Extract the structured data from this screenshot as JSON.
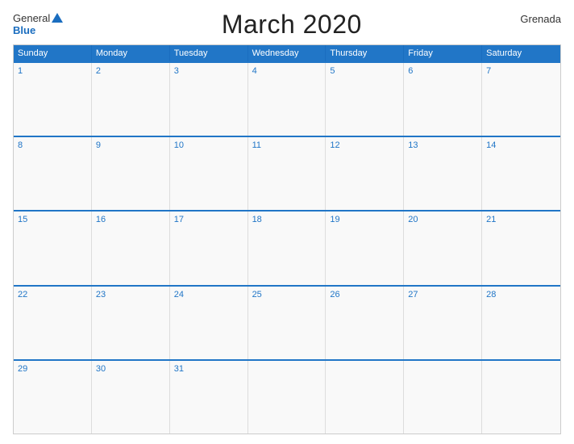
{
  "header": {
    "logo_general": "General",
    "logo_blue": "Blue",
    "title": "March 2020",
    "country": "Grenada"
  },
  "days_of_week": [
    "Sunday",
    "Monday",
    "Tuesday",
    "Wednesday",
    "Thursday",
    "Friday",
    "Saturday"
  ],
  "weeks": [
    [
      {
        "day": 1
      },
      {
        "day": 2
      },
      {
        "day": 3
      },
      {
        "day": 4
      },
      {
        "day": 5
      },
      {
        "day": 6
      },
      {
        "day": 7
      }
    ],
    [
      {
        "day": 8
      },
      {
        "day": 9
      },
      {
        "day": 10
      },
      {
        "day": 11
      },
      {
        "day": 12
      },
      {
        "day": 13
      },
      {
        "day": 14
      }
    ],
    [
      {
        "day": 15
      },
      {
        "day": 16
      },
      {
        "day": 17
      },
      {
        "day": 18
      },
      {
        "day": 19
      },
      {
        "day": 20
      },
      {
        "day": 21
      }
    ],
    [
      {
        "day": 22
      },
      {
        "day": 23
      },
      {
        "day": 24
      },
      {
        "day": 25
      },
      {
        "day": 26
      },
      {
        "day": 27
      },
      {
        "day": 28
      }
    ],
    [
      {
        "day": 29
      },
      {
        "day": 30
      },
      {
        "day": 31
      },
      {
        "day": null
      },
      {
        "day": null
      },
      {
        "day": null
      },
      {
        "day": null
      }
    ]
  ]
}
